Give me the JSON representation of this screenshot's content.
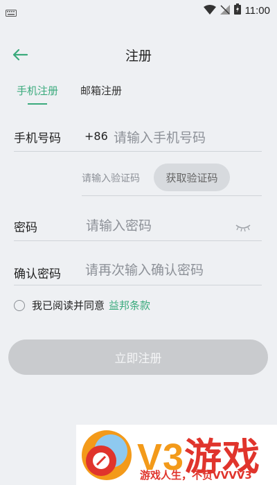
{
  "status_bar": {
    "time": "11:00"
  },
  "header": {
    "title": "注册"
  },
  "tabs": [
    {
      "label": "手机注册",
      "active": true
    },
    {
      "label": "邮箱注册",
      "active": false
    }
  ],
  "form": {
    "phone": {
      "label": "手机号码",
      "country_code": "+86",
      "placeholder": "请输入手机号码"
    },
    "verify": {
      "placeholder": "请输入验证码",
      "button_label": "获取验证码"
    },
    "password": {
      "label": "密码",
      "placeholder": "请输入密码"
    },
    "confirm": {
      "label": "确认密码",
      "placeholder": "请再次输入确认密码"
    }
  },
  "agreement": {
    "text": "我已阅读并同意",
    "link": "益邦条款"
  },
  "register_button": "立即注册",
  "watermark": {
    "big_latin": "V3",
    "big_cn": "游戏",
    "slogan": "游戏人生，不负VVVV3"
  },
  "colors": {
    "accent": "#3aaa7c",
    "background": "#eef0f3",
    "button_disabled": "#c9cbce"
  }
}
